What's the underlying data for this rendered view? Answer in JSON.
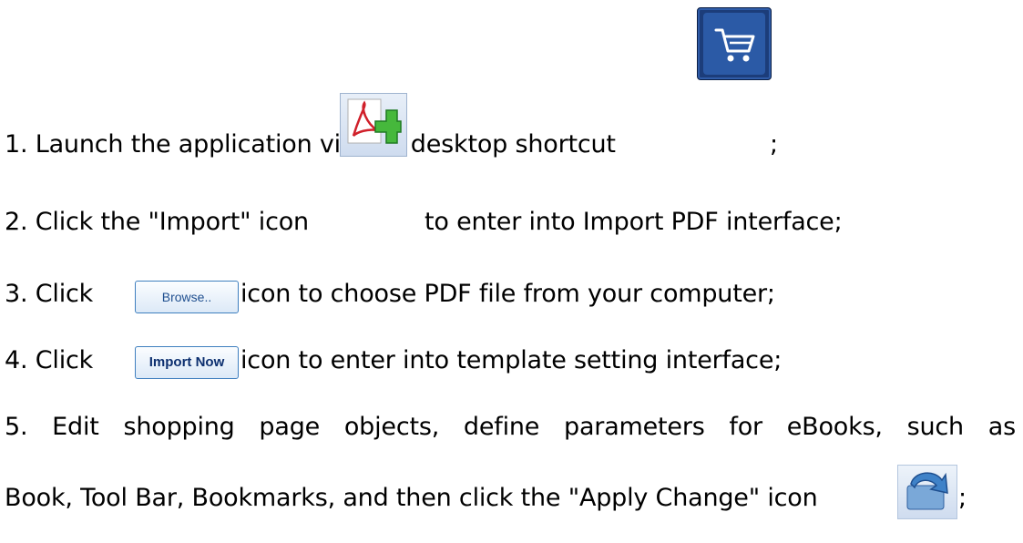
{
  "steps": {
    "s1": {
      "text": "1. Launch the application via the desktop shortcut",
      "suffix": ";"
    },
    "s2": {
      "prefix": "2. Click the \"Import\" icon",
      "suffix": "to enter into Import PDF interface;"
    },
    "s3": {
      "prefix": "3. Click",
      "suffix": "icon to choose PDF file from your computer;"
    },
    "s4": {
      "prefix": "4. Click",
      "suffix": "icon to enter into template setting interface;"
    },
    "s5": {
      "line1": "5. Edit shopping page objects, define parameters for eBooks, such as",
      "line2": "Book, Tool Bar, Bookmarks, and then click the \"Apply Change\" icon",
      "suffix": ";"
    }
  },
  "buttons": {
    "browse_label": "Browse..",
    "import_now_label": "Import Now"
  },
  "icons": {
    "cart": "shopping-cart-icon",
    "import": "import-pdf-icon",
    "apply": "apply-change-icon"
  }
}
